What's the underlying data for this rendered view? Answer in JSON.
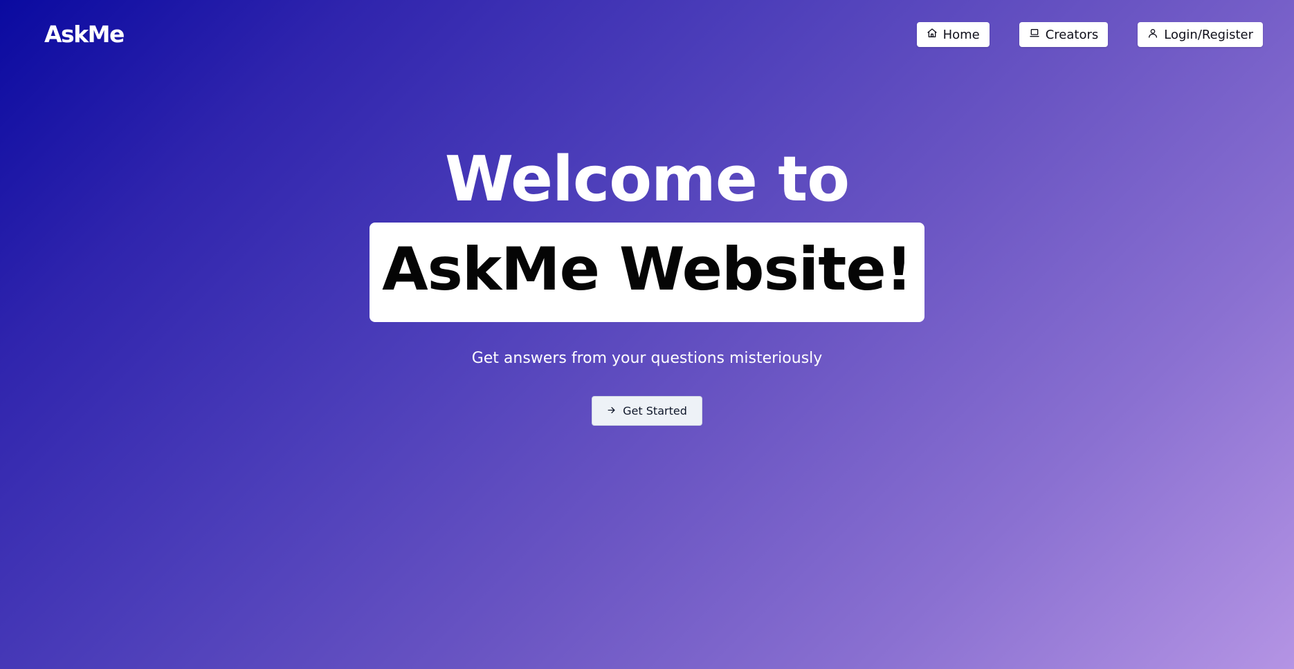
{
  "header": {
    "logo": "AskMe",
    "nav": [
      {
        "label": "Home",
        "icon": "home-icon"
      },
      {
        "label": "Creators",
        "icon": "laptop-icon"
      },
      {
        "label": "Login/Register",
        "icon": "user-icon"
      }
    ]
  },
  "hero": {
    "title_line1": "Welcome to",
    "title_line2": "AskMe Website!",
    "subtitle": "Get answers from your questions misteriously",
    "cta": {
      "label": "Get Started",
      "icon": "arrow-right-icon"
    }
  },
  "colors": {
    "gradient_start": "#0a0aa0",
    "gradient_end": "#b494e4",
    "button_bg": "#ffffff",
    "cta_bg": "#eef2f7"
  }
}
